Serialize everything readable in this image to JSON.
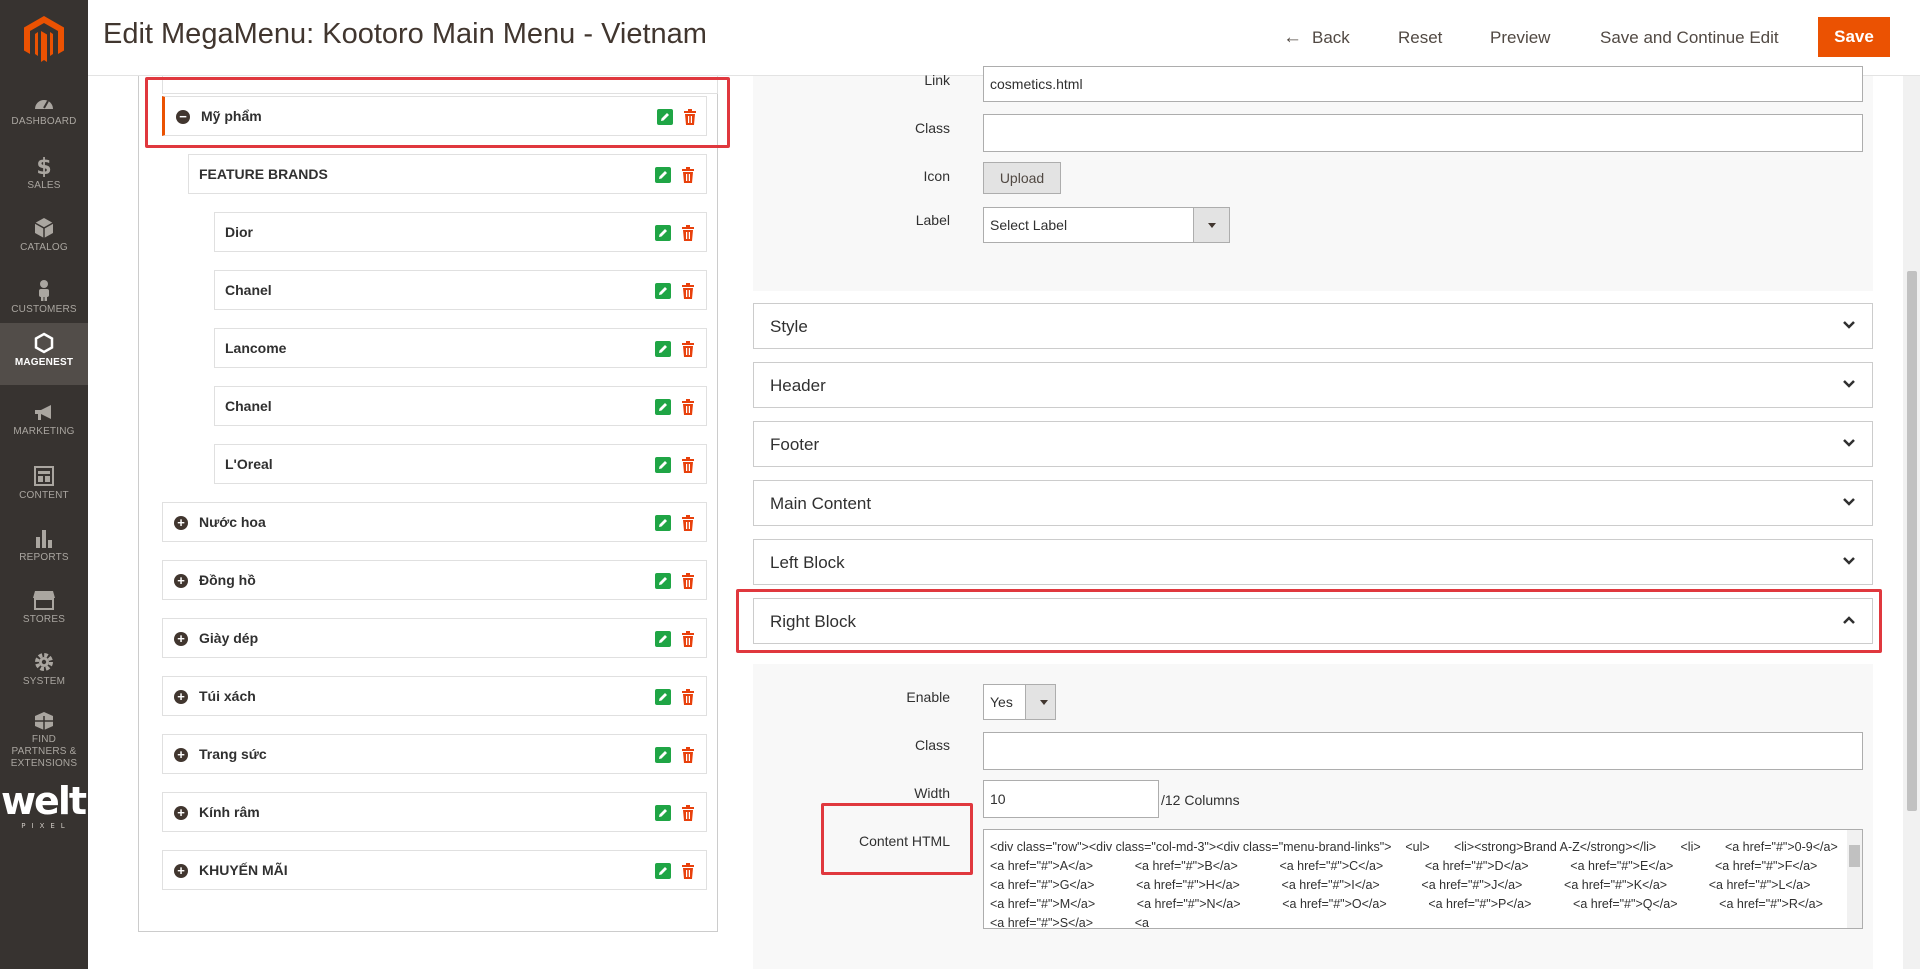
{
  "window": {
    "title": "Edit MegaMenu: Kootoro Main Menu - Vietnam"
  },
  "header": {
    "back_label": "Back",
    "reset_label": "Reset",
    "preview_label": "Preview",
    "save_continue_label": "Save and Continue Edit",
    "save_label": "Save"
  },
  "sidebar": {
    "items": [
      {
        "label": "DASHBOARD",
        "icon": "dashboard-icon"
      },
      {
        "label": "SALES",
        "icon": "dollar-icon"
      },
      {
        "label": "CATALOG",
        "icon": "cube-icon"
      },
      {
        "label": "CUSTOMERS",
        "icon": "person-icon"
      },
      {
        "label": "MAGENEST",
        "icon": "hexagon-icon",
        "active": true
      },
      {
        "label": "MARKETING",
        "icon": "megaphone-icon"
      },
      {
        "label": "CONTENT",
        "icon": "content-icon"
      },
      {
        "label": "REPORTS",
        "icon": "bar-chart-icon"
      },
      {
        "label": "STORES",
        "icon": "storefront-icon"
      },
      {
        "label": "SYSTEM",
        "icon": "gear-icon"
      },
      {
        "label": "FIND PARTNERS & EXTENSIONS",
        "icon": "boxes-icon"
      }
    ],
    "partner_logo": {
      "word": "welt",
      "sub": "PIXEL"
    }
  },
  "tree": {
    "items": [
      {
        "label": "Mỹ phẩm",
        "toggle": "−"
      },
      {
        "label": "FEATURE BRANDS"
      },
      {
        "label": "Dior"
      },
      {
        "label": "Chanel"
      },
      {
        "label": "Lancome"
      },
      {
        "label": "Chanel"
      },
      {
        "label": "L'Oreal"
      },
      {
        "label": "Nước hoa",
        "toggle": "+"
      },
      {
        "label": "Đồng hồ",
        "toggle": "+"
      },
      {
        "label": "Giày dép",
        "toggle": "+"
      },
      {
        "label": "Túi xách",
        "toggle": "+"
      },
      {
        "label": "Trang sức",
        "toggle": "+"
      },
      {
        "label": "Kính râm",
        "toggle": "+"
      },
      {
        "label": "KHUYẾN MÃI",
        "toggle": "+"
      }
    ]
  },
  "form": {
    "link_label": "Link",
    "link_value": "cosmetics.html",
    "class_label": "Class",
    "class_value": "",
    "icon_label": "Icon",
    "upload_label": "Upload",
    "label_label": "Label",
    "label_select": "Select Label"
  },
  "sections": {
    "style": "Style",
    "header": "Header",
    "footer": "Footer",
    "main_content": "Main Content",
    "left_block": "Left Block",
    "right_block": "Right Block"
  },
  "right_block": {
    "enable_label": "Enable",
    "enable_value": "Yes",
    "class_label": "Class",
    "class_value": "",
    "width_label": "Width",
    "width_value": "10",
    "width_suffix": "/12 Columns",
    "content_label": "Content HTML",
    "content_html": "<div class=\"row\"><div class=\"col-md-3\"><div class=\"menu-brand-links\">    <ul>       <li><strong>Brand A-Z</strong></li>       <li>       <a href=\"#\">0-9</a>            <a href=\"#\">A</a>            <a href=\"#\">B</a>            <a href=\"#\">C</a>            <a href=\"#\">D</a>            <a href=\"#\">E</a>            <a href=\"#\">F</a>            <a href=\"#\">G</a>            <a href=\"#\">H</a>            <a href=\"#\">I</a>            <a href=\"#\">J</a>            <a href=\"#\">K</a>            <a href=\"#\">L</a>            <a href=\"#\">M</a>            <a href=\"#\">N</a>            <a href=\"#\">O</a>            <a href=\"#\">P</a>            <a href=\"#\">Q</a>            <a href=\"#\">R</a>            <a href=\"#\">S</a>            <a"
  },
  "colors": {
    "accent": "#eb5202",
    "sidebar": "#373330",
    "edit_green": "#1fa545",
    "highlight_red": "#e0383e"
  }
}
